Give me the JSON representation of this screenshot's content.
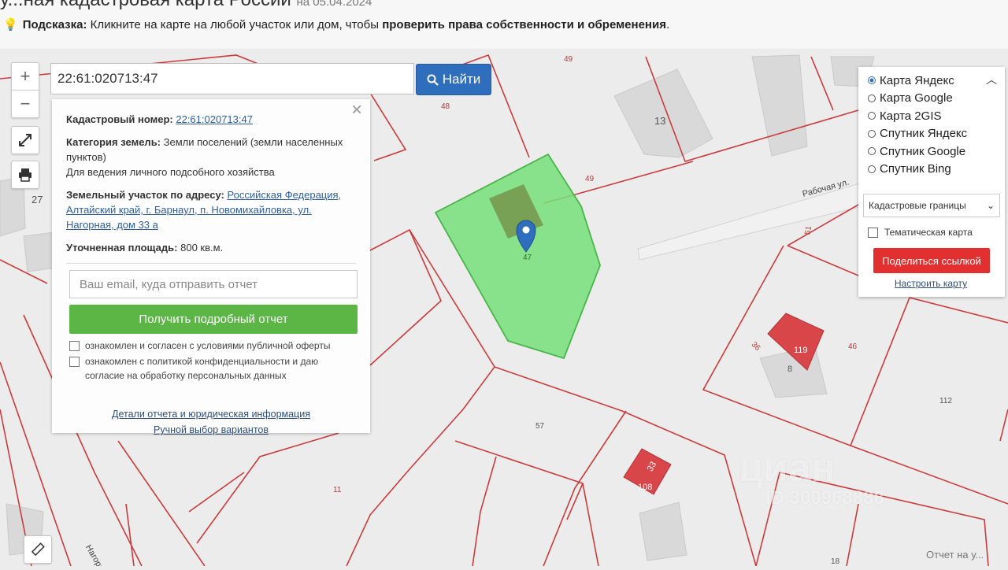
{
  "header": {
    "title": "у...ная кадастровая карта России",
    "date": "на 05.04.2024",
    "hint_label": "Подсказка:",
    "hint_text": " Кликните на карте на любой участок или дом, чтобы ",
    "hint_bold": "проверить права собственности и обременения",
    "hint_end": "."
  },
  "search": {
    "value": "22:61:020713:47",
    "button_label": "Найти"
  },
  "info": {
    "cad_label": "Кадастровый номер:",
    "cad_value": "22:61:020713:47",
    "cat_label": "Категория земель:",
    "cat_value": "Земли поселений (земли населенных пунктов)",
    "use_value": "Для ведения личного подсобного хозяйства",
    "addr_label": "Земельный участок по адресу:",
    "addr_value": "Российская Федерация, Алтайский край, г. Барнаул, п. Новомихайловка, ул. Нагорная, дом 33 а",
    "area_label": "Уточненная площадь:",
    "area_value": "800 кв.м.",
    "email_placeholder": "Ваш email, куда отправить отчет",
    "report_button": "Получить подробный отчет",
    "check1": "ознакомлен и согласен с условиями публичной оферты",
    "check2": "ознакомлен с политикой конфиденциальности и даю согласие на обработку персональных данных",
    "link1": "Детали отчета и юридическая информация",
    "link2": "Ручной выбор вариантов"
  },
  "layers": {
    "options": [
      "Карта Яндекс",
      "Карта Google",
      "Карта 2GIS",
      "Спутник Яндекс",
      "Спутник Google",
      "Спутник Bing"
    ],
    "selected": 0,
    "select_value": "Кадастровые границы",
    "thematic_label": "Тематическая карта",
    "share_button": "Поделиться ссылкой",
    "configure_link": "Настроить карту"
  },
  "map_labels": {
    "n49a": "49",
    "n48": "48",
    "n13": "13",
    "n49b": "49",
    "n27": "27",
    "n47": "47",
    "n51": "51",
    "n119": "119",
    "n46": "46",
    "n8": "8",
    "n112": "112",
    "n57": "57",
    "n11": "11",
    "n108": "108",
    "n18": "18",
    "n33": "33",
    "n36": "36",
    "street1": "Рабочая ул.",
    "street2": "Нагорная ул."
  },
  "watermark": {
    "brand": "циан",
    "id": "ID 300968888"
  },
  "corner_note": "Отчет на у..."
}
